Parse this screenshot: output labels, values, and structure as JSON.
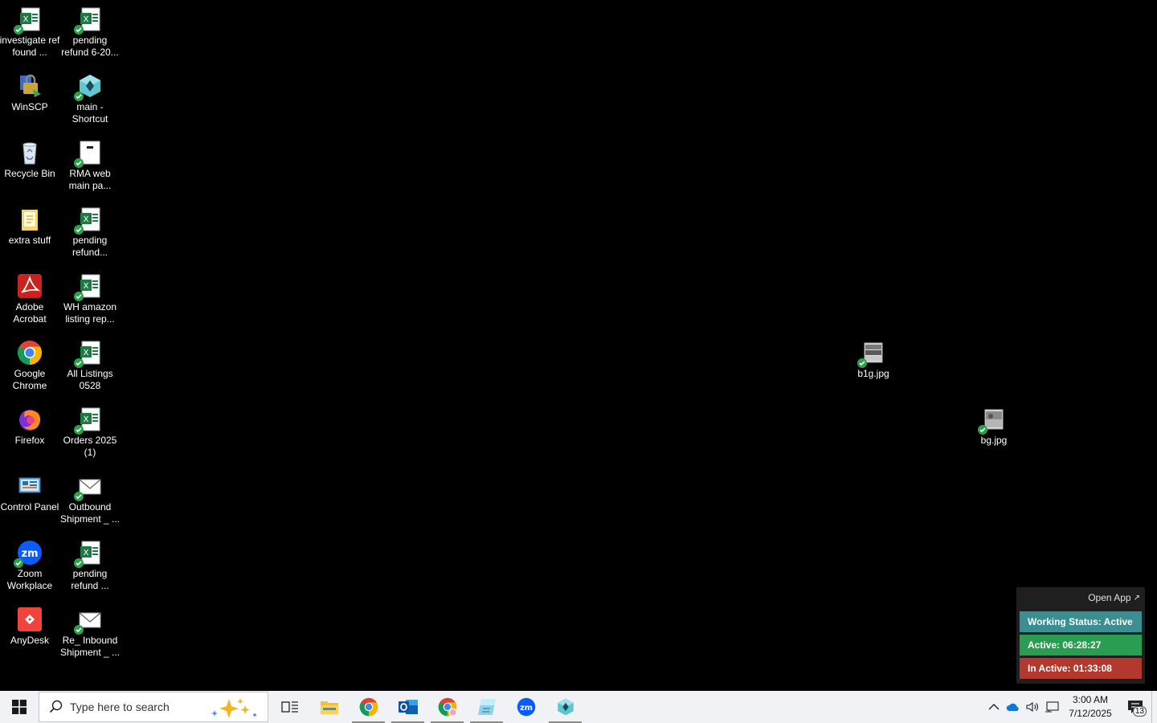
{
  "desktop": {
    "icons": [
      {
        "label": "investigate ref found ...",
        "type": "excel-file"
      },
      {
        "label": "pending refund 6-20...",
        "type": "excel-file"
      },
      {
        "label": "WinSCP",
        "type": "winscp-app"
      },
      {
        "label": "main - Shortcut",
        "type": "app-shortcut"
      },
      {
        "label": "Recycle Bin",
        "type": "recycle-bin"
      },
      {
        "label": "RMA web main pa...",
        "type": "web-page"
      },
      {
        "label": "extra stuff",
        "type": "folder"
      },
      {
        "label": "pending refund...",
        "type": "excel-file"
      },
      {
        "label": "Adobe Acrobat",
        "type": "acrobat-app"
      },
      {
        "label": "WH amazon listing rep...",
        "type": "excel-file"
      },
      {
        "label": "Google Chrome",
        "type": "chrome-app"
      },
      {
        "label": "All Listings 0528",
        "type": "excel-file"
      },
      {
        "label": "Firefox",
        "type": "firefox-app"
      },
      {
        "label": "Orders 2025 (1)",
        "type": "excel-file"
      },
      {
        "label": "Control Panel",
        "type": "control-panel"
      },
      {
        "label": "Outbound Shipment _ ...",
        "type": "mail-file"
      },
      {
        "label": "Zoom Workplace",
        "type": "zoom-app"
      },
      {
        "label": "pending refund ...",
        "type": "excel-file"
      },
      {
        "label": "AnyDesk",
        "type": "anydesk-app"
      },
      {
        "label": "Re_ Inbound Shipment _ ...",
        "type": "mail-file"
      },
      {
        "label": "b1g.jpg",
        "type": "image-file"
      },
      {
        "label": "bg.jpg",
        "type": "image-file"
      }
    ]
  },
  "widget": {
    "open_app": "Open App",
    "working_status": "Working Status: Active",
    "active": "Active: 06:28:27",
    "inactive": "In Active: 01:33:08",
    "colors": {
      "working": "#3a8f92",
      "active": "#2a9d52",
      "inactive": "#b3392f",
      "bg": "#1f1f1f"
    }
  },
  "taskbar": {
    "search_placeholder": "Type here to search",
    "apps": [
      "task-view",
      "file-explorer",
      "chrome",
      "outlook",
      "chrome-profile",
      "notepad-app",
      "zoom",
      "main-app"
    ],
    "clock_time": "3:00 AM",
    "clock_date": "7/12/2025",
    "notification_count": "13"
  }
}
